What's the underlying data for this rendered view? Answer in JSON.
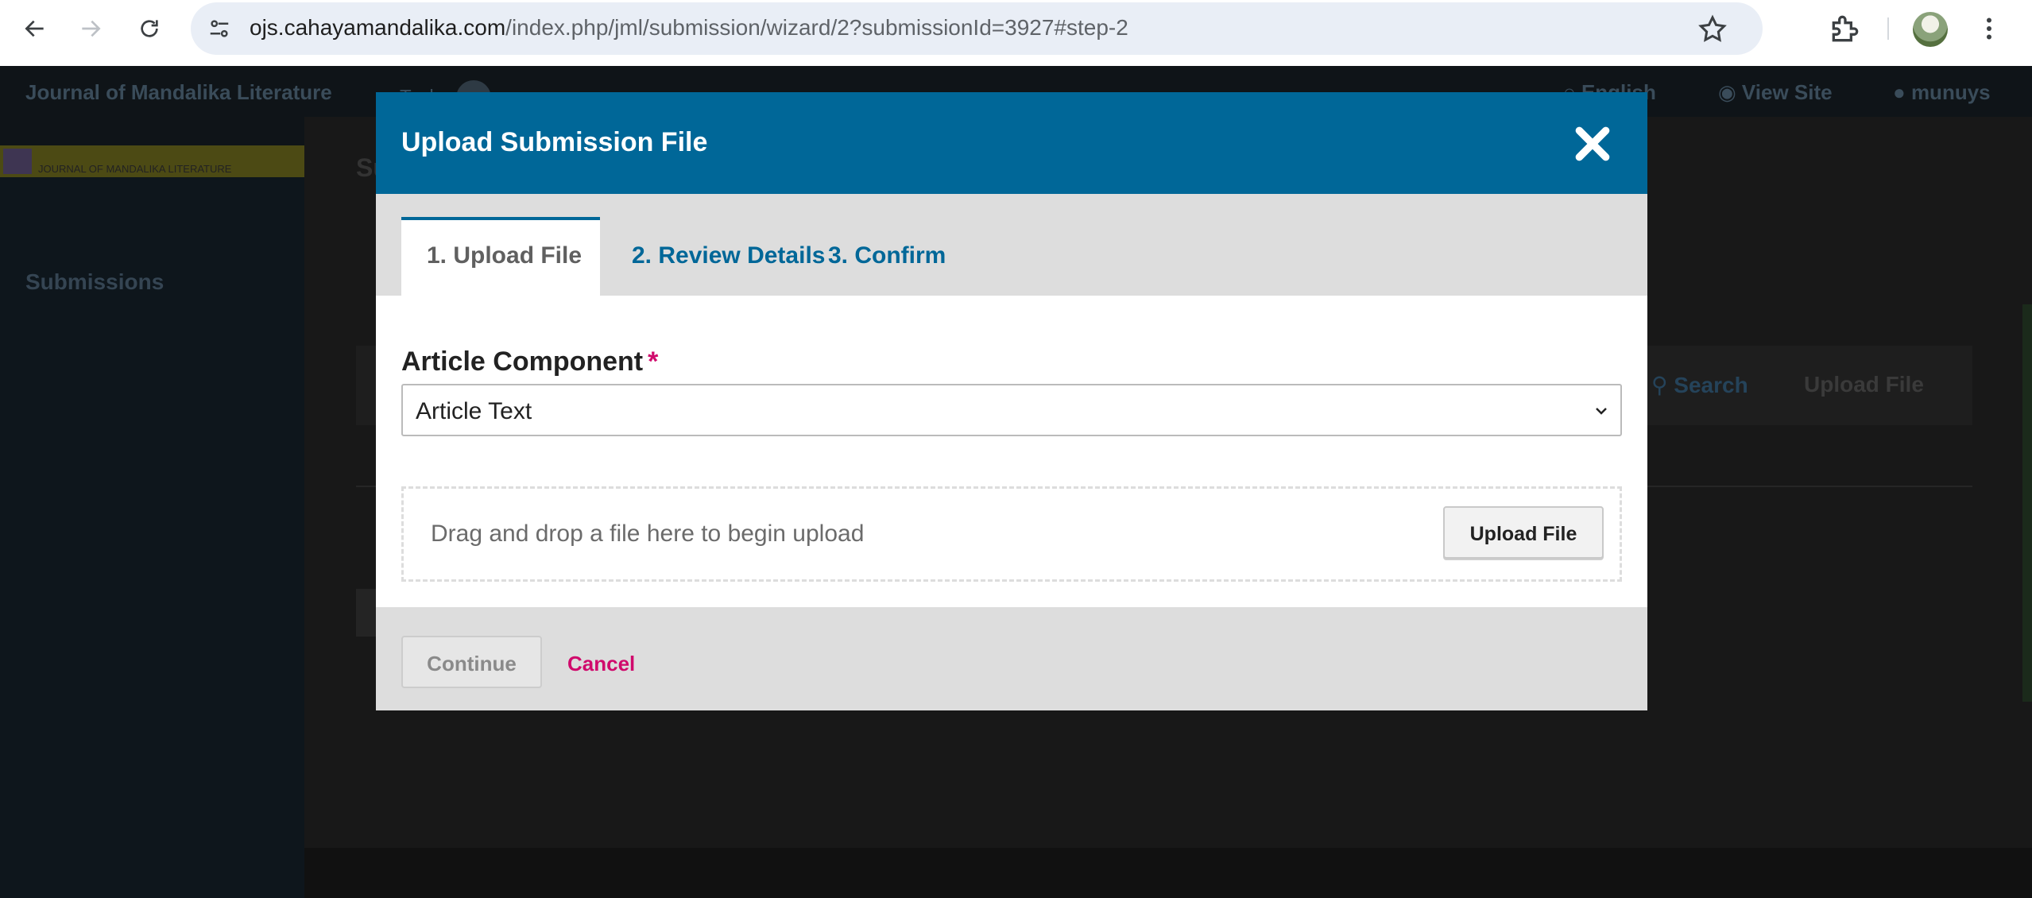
{
  "browser": {
    "url_host": "ojs.cahayamandalika.com",
    "url_path": "/index.php/jml/submission/wizard/2?submissionId=3927#step-2",
    "icons": [
      "back-icon",
      "forward-icon",
      "reload-icon",
      "site-info-icon",
      "star-icon",
      "extensions-icon",
      "avatar",
      "menu-icon"
    ]
  },
  "app": {
    "title": "Journal of Mandalika Literature",
    "tasks_label": "Tasks",
    "language": "English",
    "view_site": "View Site",
    "username": "munuys",
    "logo_text": "JOURNAL OF MANDALIKA LITERATURE",
    "sidebar_submissions": "Submissions",
    "main_title_fragment": "Su",
    "main_search": "Search",
    "main_upload": "Upload File"
  },
  "modal": {
    "title": "Upload Submission File",
    "tabs": [
      {
        "label": "1. Upload File",
        "active": true
      },
      {
        "label": "2. Review Details",
        "active": false
      },
      {
        "label": "3. Confirm",
        "active": false
      }
    ],
    "field_label": "Article Component",
    "required_mark": "*",
    "selected_component": "Article Text",
    "dropzone_text": "Drag and drop a file here to begin upload",
    "upload_button": "Upload File",
    "continue_button": "Continue",
    "cancel_link": "Cancel"
  },
  "colors": {
    "primary": "#006798",
    "required": "#d00a6c",
    "cancel": "#d00a6c"
  }
}
